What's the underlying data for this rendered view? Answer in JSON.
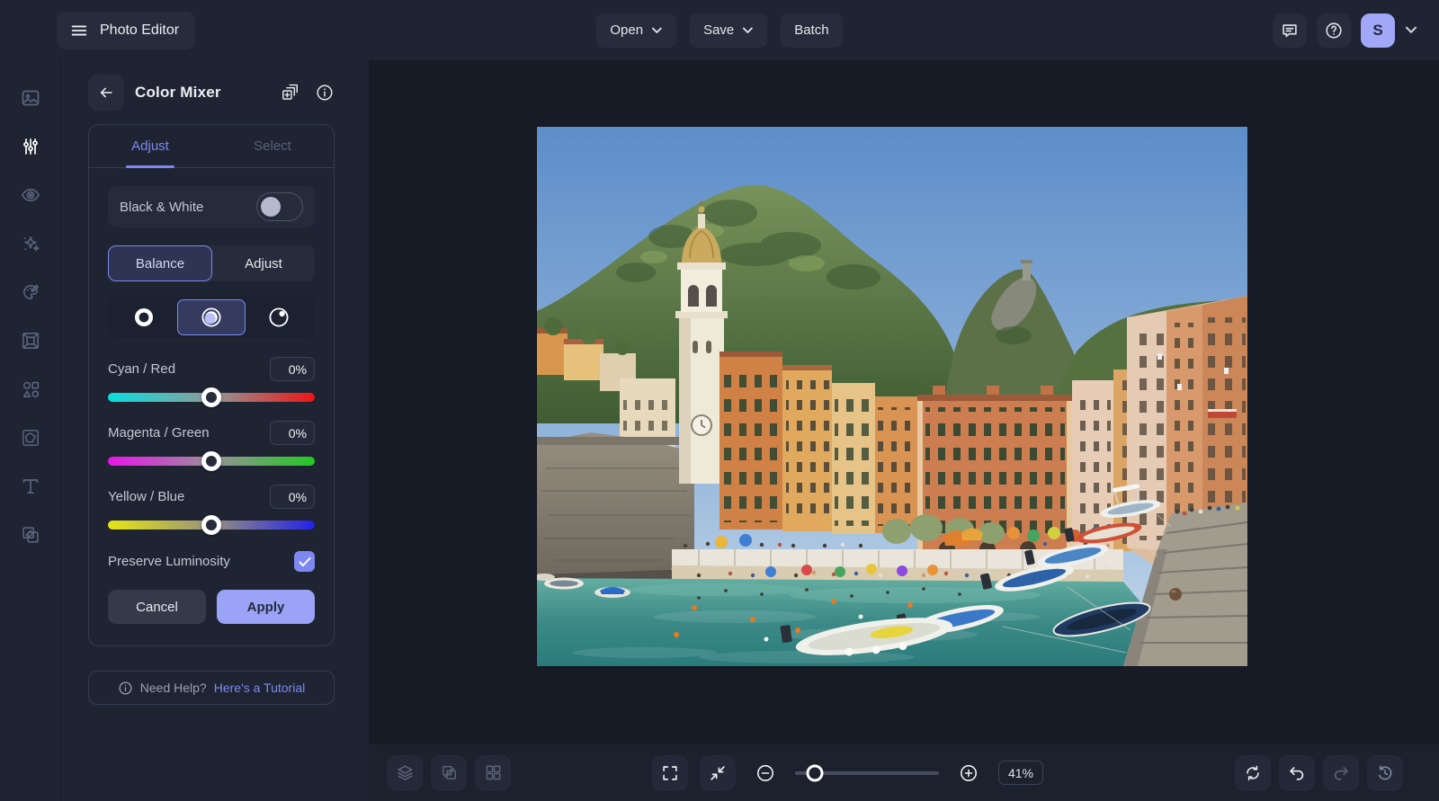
{
  "topbar": {
    "app_title": "Photo Editor",
    "open_label": "Open",
    "save_label": "Save",
    "batch_label": "Batch",
    "avatar_initial": "S",
    "icons": [
      "menu-icon",
      "chevron-down-icon",
      "feedback-icon",
      "help-icon"
    ]
  },
  "sidebar": {
    "icons": [
      "image-icon",
      "adjustments-icon",
      "retouch-icon",
      "effects-icon",
      "paint-icon",
      "frame-icon",
      "shapes-icon",
      "texture-icon",
      "text-icon",
      "arrange-icon"
    ],
    "active_icon": "adjustments-icon"
  },
  "panel": {
    "title": "Color Mixer",
    "header_icons": [
      "duplicate-icon",
      "info-icon"
    ],
    "tabs": [
      {
        "label": "Adjust",
        "active": true
      },
      {
        "label": "Select",
        "active": false
      }
    ],
    "black_white": {
      "label": "Black & White",
      "enabled": false
    },
    "mode_toggle": {
      "options": [
        "Balance",
        "Adjust"
      ],
      "selected": "Balance"
    },
    "tone_range": {
      "options": [
        "shadows",
        "midtones",
        "highlights"
      ],
      "selected": "midtones"
    },
    "sliders": [
      {
        "label": "Cyan / Red",
        "value": "0%",
        "position_pct": 50,
        "gradient": [
          "#0adede",
          "#8f9a9a",
          "#ee1414"
        ]
      },
      {
        "label": "Magenta / Green",
        "value": "0%",
        "position_pct": 50,
        "gradient": [
          "#e816e8",
          "#9a8f9a",
          "#22c922"
        ]
      },
      {
        "label": "Yellow / Blue",
        "value": "0%",
        "position_pct": 50,
        "gradient": [
          "#e6e612",
          "#97917e",
          "#2222e8"
        ]
      }
    ],
    "preserve_luminosity": {
      "label": "Preserve Luminosity",
      "checked": true
    },
    "cancel_label": "Cancel",
    "apply_label": "Apply",
    "help": {
      "text": "Need Help?",
      "link_label": "Here's a Tutorial"
    }
  },
  "canvas": {
    "image_description": "Vernazza harbor photo: teal water with moored boats, beach crowd, colorful orange buildings, church bell tower and green hillside under blue sky"
  },
  "bottombar": {
    "zoom_value": "41%",
    "zoom_slider_pct": 14,
    "icons_left": [
      "layers-icon",
      "transform-icon",
      "grid-icon"
    ],
    "icons_center": [
      "fullscreen-icon",
      "fit-screen-icon",
      "zoom-out-icon",
      "zoom-in-icon"
    ],
    "icons_right": [
      "reset-icon",
      "undo-icon",
      "redo-icon",
      "history-icon"
    ]
  },
  "colors": {
    "accent": "#7d89f1",
    "accent_light": "#9aa3f5",
    "avatar_bg": "#a2a7f7",
    "panel_bg": "#1f2433",
    "canvas_bg": "#171b25"
  }
}
